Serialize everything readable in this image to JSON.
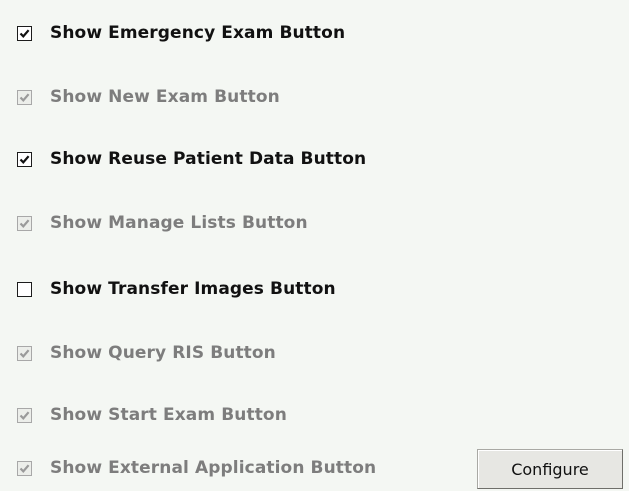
{
  "options": [
    {
      "label": "Show Emergency Exam Button",
      "checked": true,
      "enabled": true
    },
    {
      "label": "Show New Exam Button",
      "checked": true,
      "enabled": false
    },
    {
      "label": "Show Reuse Patient Data Button",
      "checked": true,
      "enabled": true
    },
    {
      "label": "Show Manage Lists Button",
      "checked": true,
      "enabled": false
    },
    {
      "label": "Show Transfer Images Button",
      "checked": false,
      "enabled": true
    },
    {
      "label": "Show Query RIS Button",
      "checked": true,
      "enabled": false
    },
    {
      "label": "Show Start Exam Button",
      "checked": true,
      "enabled": false
    },
    {
      "label": "Show External Application Button",
      "checked": true,
      "enabled": false
    }
  ],
  "configure_button": {
    "label": "Configure"
  }
}
